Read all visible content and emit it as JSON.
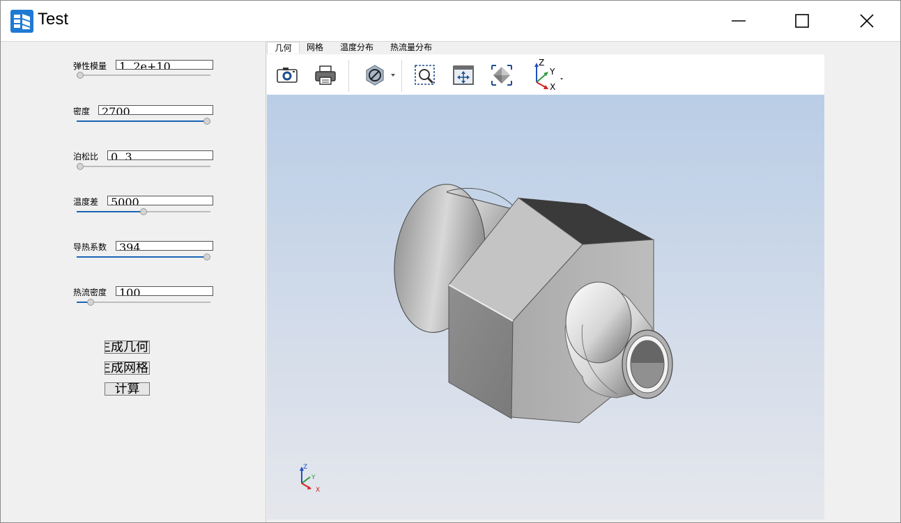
{
  "window": {
    "title": "Test"
  },
  "params": [
    {
      "label": "弹性模量",
      "value": "1. 2e+10",
      "slider_fraction": 0.0
    },
    {
      "label": "密度",
      "value": "2700",
      "slider_fraction": 1.0
    },
    {
      "label": "泊松比",
      "value": "0. 3",
      "slider_fraction": 0.0
    },
    {
      "label": "温度差",
      "value": "5000",
      "slider_fraction": 0.5
    },
    {
      "label": "导热系数",
      "value": "394",
      "slider_fraction": 1.0
    },
    {
      "label": "热流密度",
      "value": "100",
      "slider_fraction": 0.08
    }
  ],
  "buttons": {
    "generate_geometry": "生成几何",
    "generate_mesh": "生成网格",
    "compute": "计算"
  },
  "tabs": [
    "几何",
    "网格",
    "温度分布",
    "热流量分布"
  ],
  "toolbar": {
    "icons": [
      "camera-icon",
      "print-icon",
      "section-icon",
      "zoom-window-icon",
      "fit-all-icon",
      "view-cube-icon",
      "axes-view-icon"
    ]
  },
  "axes": {
    "z": "Z",
    "y": "Y",
    "x": "X"
  },
  "colors": {
    "accent": "#1a64b4",
    "viewport_top": "#b9cde6",
    "viewport_bottom": "#e5e7ec"
  }
}
